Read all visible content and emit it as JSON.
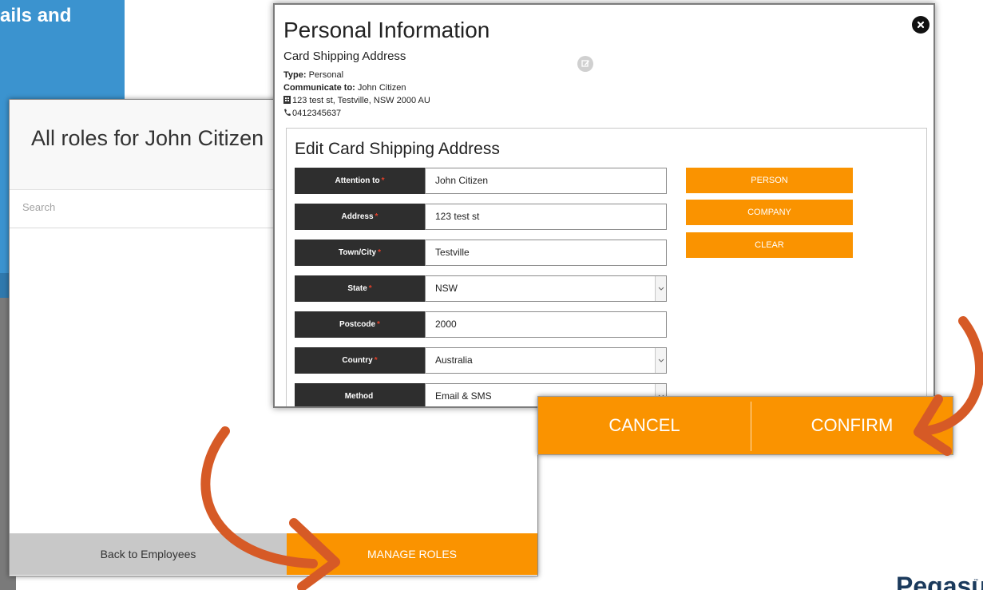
{
  "background": {
    "banner_text": "ails and"
  },
  "roles_modal": {
    "title": "All roles for John Citizen",
    "search_placeholder": "Search",
    "back_button": "Back to Employees",
    "manage_button": "MANAGE ROLES"
  },
  "personal_modal": {
    "title": "Personal Information",
    "subtitle": "Card Shipping Address",
    "type_label": "Type:",
    "type_value": "Personal",
    "communicate_label": "Communicate to:",
    "communicate_value": "John Citizen",
    "address_line": "123 test st, Testville, NSW 2000 AU",
    "phone": "0412345637",
    "icons": [
      "edit-icon",
      "close-icon",
      "building-icon",
      "phone-icon",
      "chevron-down-icon"
    ],
    "edit_section": {
      "title": "Edit Card Shipping Address",
      "fields": [
        {
          "label": "Attention to",
          "value": "John Citizen",
          "required": "*",
          "kind": "text"
        },
        {
          "label": "Address",
          "value": "123 test st",
          "required": "*",
          "kind": "text"
        },
        {
          "label": "Town/City",
          "value": "Testville",
          "required": "*",
          "kind": "text"
        },
        {
          "label": "State",
          "value": "NSW",
          "required": "*",
          "kind": "select"
        },
        {
          "label": "Postcode",
          "value": "2000",
          "required": "*",
          "kind": "text"
        },
        {
          "label": "Country",
          "value": "Australia",
          "required": "*",
          "kind": "select"
        },
        {
          "label": "Method",
          "value": "Email & SMS",
          "required": "",
          "kind": "select"
        }
      ],
      "side_buttons": [
        "PERSON",
        "COMPANY",
        "CLEAR"
      ]
    }
  },
  "action_bar": {
    "cancel": "CANCEL",
    "confirm": "CONFIRM"
  },
  "brand": {
    "logo_text": "Pegasus",
    "trademark": "™"
  },
  "colors": {
    "accent_orange": "#fa9300",
    "banner_blue": "#3b93cf",
    "label_dark": "#2e2e2e",
    "arrow_orange": "#d65a26",
    "brand_navy": "#1b3a5c"
  }
}
